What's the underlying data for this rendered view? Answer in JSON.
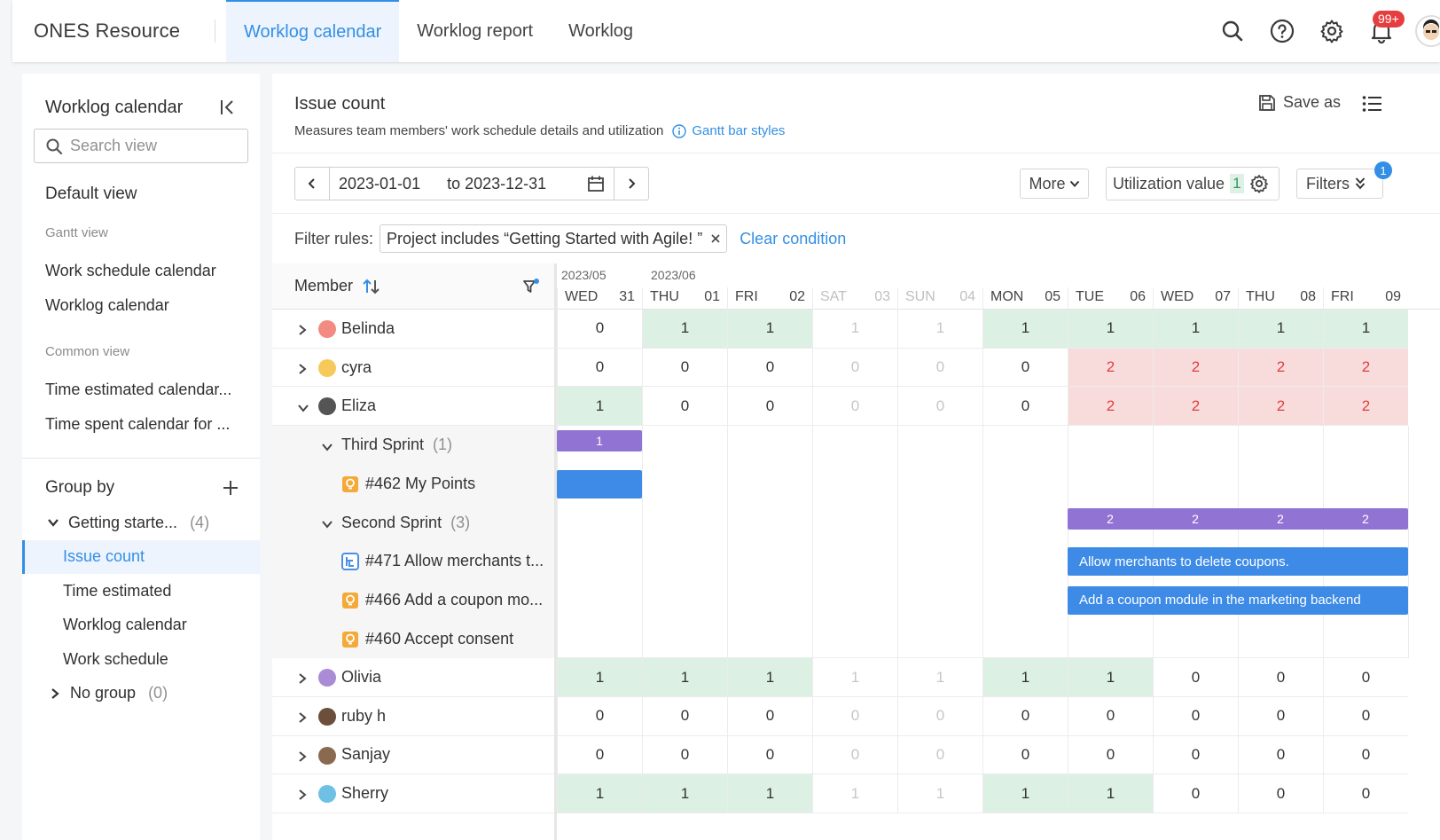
{
  "app": {
    "title": "ONES Resource"
  },
  "tabs": [
    {
      "label": "Worklog calendar",
      "active": true
    },
    {
      "label": "Worklog report",
      "active": false
    },
    {
      "label": "Worklog",
      "active": false
    }
  ],
  "topbar": {
    "notification_badge": "99+"
  },
  "sidebar": {
    "title": "Worklog calendar",
    "search_placeholder": "Search view",
    "default_view": "Default view",
    "gantt_label": "Gantt view",
    "gantt_items": [
      "Work schedule calendar",
      "Worklog calendar"
    ],
    "common_label": "Common view",
    "common_items": [
      "Time estimated calendar...",
      "Time spent calendar for ..."
    ],
    "group_by": "Group by",
    "tree": [
      {
        "label": "Getting starte...",
        "count": "(4)"
      },
      {
        "label": "Issue count",
        "selected": true
      },
      {
        "label": "Time estimated"
      },
      {
        "label": "Worklog calendar"
      },
      {
        "label": "Work schedule"
      },
      {
        "label": "No group",
        "count": "(0)"
      }
    ]
  },
  "main": {
    "title": "Issue count",
    "subtitle": "Measures team members' work schedule details and utilization",
    "gantt_link": "Gantt bar styles",
    "save_as": "Save as",
    "date_from": "2023-01-01",
    "date_to": "to 2023-12-31",
    "more": "More",
    "utilization_label": "Utilization value",
    "utilization_value": "1",
    "filters": "Filters",
    "filters_badge": "1",
    "filter_rules_label": "Filter rules:",
    "filter_tag": "Project includes “Getting Started with Agile! ”",
    "clear_condition": "Clear condition"
  },
  "grid": {
    "member_header": "Member",
    "months": [
      "2023/05",
      "2023/06"
    ],
    "days": [
      {
        "wd": "WED",
        "dn": "31",
        "weekend": false
      },
      {
        "wd": "THU",
        "dn": "01",
        "weekend": false
      },
      {
        "wd": "FRI",
        "dn": "02",
        "weekend": false
      },
      {
        "wd": "SAT",
        "dn": "03",
        "weekend": true
      },
      {
        "wd": "SUN",
        "dn": "04",
        "weekend": true
      },
      {
        "wd": "MON",
        "dn": "05",
        "weekend": false
      },
      {
        "wd": "TUE",
        "dn": "06",
        "weekend": false
      },
      {
        "wd": "WED",
        "dn": "07",
        "weekend": false
      },
      {
        "wd": "THU",
        "dn": "08",
        "weekend": false
      },
      {
        "wd": "FRI",
        "dn": "09",
        "weekend": false
      }
    ],
    "members": [
      {
        "name": "Belinda",
        "values": [
          0,
          1,
          1,
          1,
          1,
          1,
          1,
          1,
          1,
          1
        ],
        "avatar_color": "#f28b82"
      },
      {
        "name": "cyra",
        "values": [
          0,
          0,
          0,
          0,
          0,
          0,
          2,
          2,
          2,
          2
        ],
        "avatar_color": "#f6c95a"
      },
      {
        "name": "Eliza",
        "values": [
          1,
          0,
          0,
          0,
          0,
          0,
          2,
          2,
          2,
          2
        ],
        "avatar_color": "#555555",
        "expanded": true
      },
      {
        "name": "Olivia",
        "values": [
          1,
          1,
          1,
          1,
          1,
          1,
          1,
          0,
          0,
          0
        ],
        "avatar_color": "#a98bd6"
      },
      {
        "name": "ruby h",
        "values": [
          0,
          0,
          0,
          0,
          0,
          0,
          0,
          0,
          0,
          0
        ],
        "avatar_color": "#6b4f3a"
      },
      {
        "name": "Sanjay",
        "values": [
          0,
          0,
          0,
          0,
          0,
          0,
          0,
          0,
          0,
          0
        ],
        "avatar_color": "#8a6a4f"
      },
      {
        "name": "Sherry",
        "values": [
          1,
          1,
          1,
          1,
          1,
          1,
          1,
          0,
          0,
          0
        ],
        "avatar_color": "#6ec1e4"
      }
    ],
    "subrows": [
      {
        "type": "sprint",
        "label": "Third Sprint",
        "count": "(1)"
      },
      {
        "type": "issue",
        "label": "#462 My Points",
        "icon": "bulb"
      },
      {
        "type": "sprint",
        "label": "Second Sprint",
        "count": "(3)"
      },
      {
        "type": "issue",
        "label": "#471 Allow merchants t...",
        "icon": "story"
      },
      {
        "type": "issue",
        "label": "#466 Add a coupon mo...",
        "icon": "bulb"
      },
      {
        "type": "issue",
        "label": "#460 Accept consent",
        "icon": "bulb"
      }
    ],
    "bars": {
      "third_sprint_value": "1",
      "second_sprint_values": [
        "2",
        "2",
        "2",
        "2"
      ],
      "task_471": "Allow merchants to delete coupons.",
      "task_466": "Add a coupon module in the marketing backend"
    }
  },
  "colors": {
    "accent": "#338fe5",
    "green_cell": "#dcf0e4",
    "red_cell": "#f8dcdc",
    "sprint_bar": "#9173d3",
    "task_bar": "#3d8be6"
  }
}
